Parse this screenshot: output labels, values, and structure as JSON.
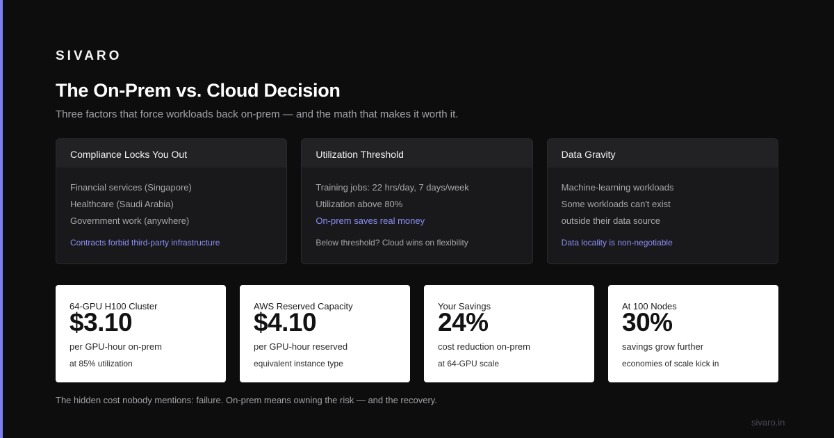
{
  "brand": "SIVARO",
  "title": "The On-Prem vs. Cloud Decision",
  "subtitle": "Three factors that force workloads back on-prem — and the math that makes it worth it.",
  "accent_color": "#7b7ff0",
  "cards": [
    {
      "heading": "Compliance Locks You Out",
      "lines": [
        "Financial services (Singapore)",
        "Healthcare (Saudi Arabia)",
        "Government work (anywhere)"
      ],
      "footer": "Contracts forbid third-party infrastructure"
    },
    {
      "heading": "Utilization Threshold",
      "lines": [
        "Training jobs: 22 hrs/day, 7 days/week",
        "Utilization above 80%",
        "On-prem saves real money"
      ],
      "footer": "Below threshold? Cloud wins on flexibility"
    },
    {
      "heading": "Data Gravity",
      "lines": [
        "Machine-learning workloads",
        "Some workloads can't exist",
        "outside their data source"
      ],
      "footer": "Data locality is non-negotiable"
    }
  ],
  "stats": [
    {
      "label": "64-GPU H100 Cluster",
      "value": "$3.10",
      "line1": "per GPU-hour on-prem",
      "line2": "at 85% utilization"
    },
    {
      "label": "AWS Reserved Capacity",
      "value": "$4.10",
      "line1": "per GPU-hour reserved",
      "line2": "equivalent instance type"
    },
    {
      "label": "Your Savings",
      "value": "24%",
      "line1": "cost reduction on-prem",
      "line2": "at 64-GPU scale"
    },
    {
      "label": "At 100 Nodes",
      "value": "30%",
      "line1": "savings grow further",
      "line2": "economies of scale kick in"
    }
  ],
  "footnote": "The hidden cost nobody mentions: failure. On-prem means owning the risk — and the recovery.",
  "site": "sivaro.in"
}
